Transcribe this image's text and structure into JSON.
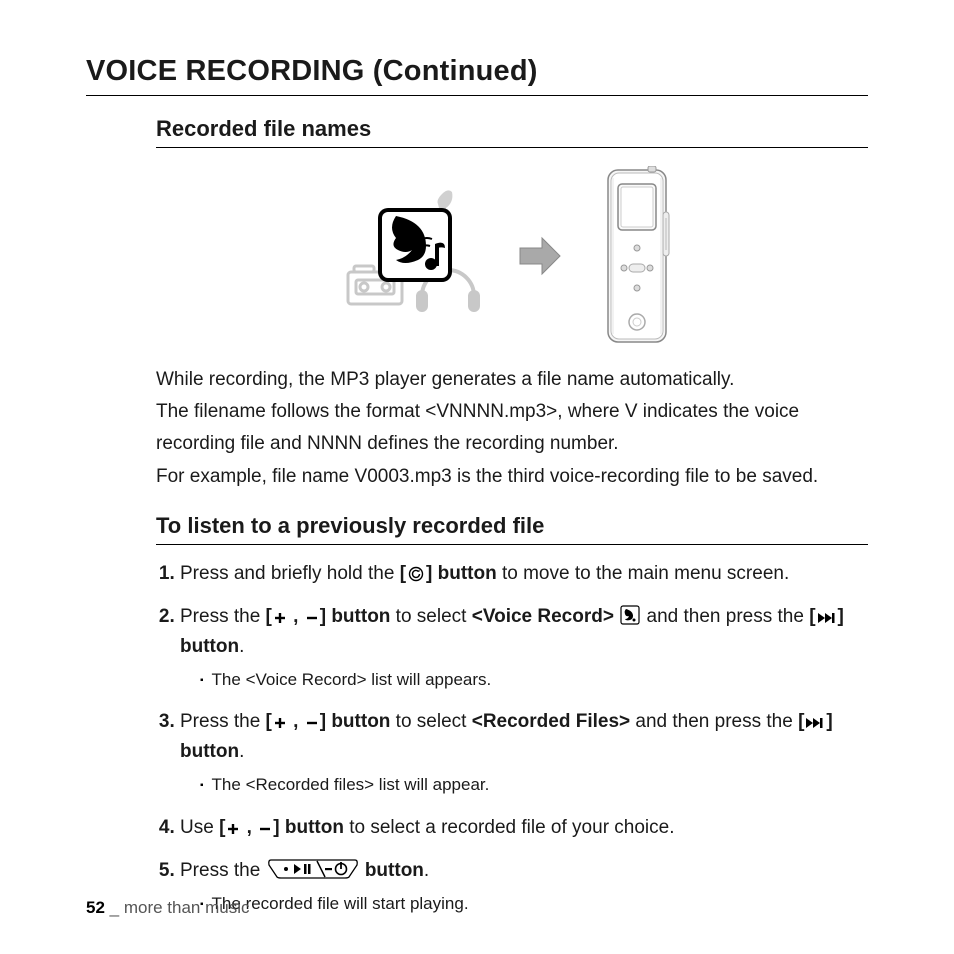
{
  "title": "VOICE RECORDING (Continued)",
  "section1": {
    "heading": "Recorded file names",
    "p1": "While recording, the MP3 player generates a file name automatically.",
    "p2": "The filename follows the format <VNNNN.mp3>, where V indicates the voice recording file and NNNN defines the recording number.",
    "p3": "For example, file name V0003.mp3 is the third voice-recording file to be saved."
  },
  "section2": {
    "heading": "To listen to a previously recorded file",
    "steps": {
      "s1a": "Press and briefly hold the ",
      "s1b": " button",
      "s1c": " to move to the main menu screen.",
      "s2a": "Press the ",
      "s2b": " button",
      "s2c": " to select ",
      "s2d": "<Voice Record>",
      "s2e": " and then press the ",
      "s2f": " button",
      "s2g": ".",
      "s2sub": "The <Voice Record> list will appears.",
      "s3a": "Press the ",
      "s3b": " button",
      "s3c": " to select ",
      "s3d": "<Recorded Files>",
      "s3e": " and then press the ",
      "s3f": " button",
      "s3g": ".",
      "s3sub": "The <Recorded files> list will appear.",
      "s4a": "Use ",
      "s4b": " button",
      "s4c": " to select a recorded file of your choice.",
      "s5a": "Press the ",
      "s5b": " button",
      "s5c": ".",
      "s5sub": "The recorded file will start playing."
    }
  },
  "footer": {
    "page": "52",
    "sep": " _ ",
    "label": "more than music"
  },
  "glyphs": {
    "lbr": "[",
    "rbr": "]",
    "plus": "＋",
    "minus": "－",
    "comma": " , "
  }
}
